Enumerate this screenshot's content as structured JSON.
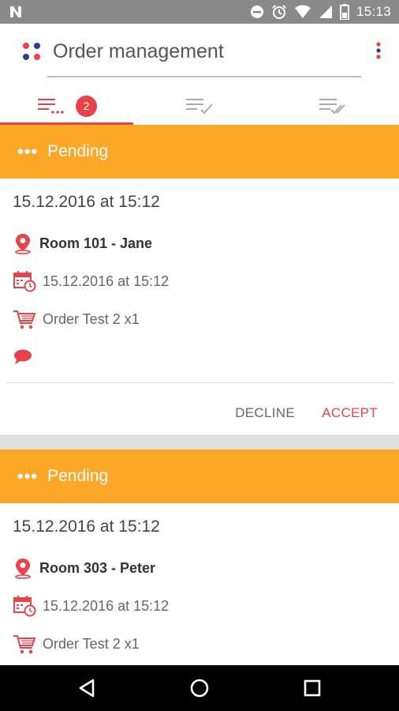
{
  "status_bar": {
    "time": "15:13"
  },
  "app_bar": {
    "title": "Order management",
    "tabs": [
      {
        "name": "pending",
        "icon": "list-pending-icon",
        "badge": "2",
        "selected": true
      },
      {
        "name": "accepted",
        "icon": "list-check-icon",
        "selected": false
      },
      {
        "name": "completed",
        "icon": "list-double-check-icon",
        "selected": false
      }
    ]
  },
  "colors": {
    "accent": "#e8424a",
    "pending": "#fda729"
  },
  "orders": [
    {
      "status": "Pending",
      "date": "15.12.2016 at 15:12",
      "location": "Room 101 - Jane",
      "scheduled": "15.12.2016 at 15:12",
      "items": "Order Test 2 x1",
      "decline_label": "DECLINE",
      "accept_label": "ACCEPT"
    },
    {
      "status": "Pending",
      "date": "15.12.2016 at 15:12",
      "location": "Room 303 - Peter",
      "scheduled": "15.12.2016 at 15:12",
      "items": "Order Test 2 x1"
    }
  ]
}
